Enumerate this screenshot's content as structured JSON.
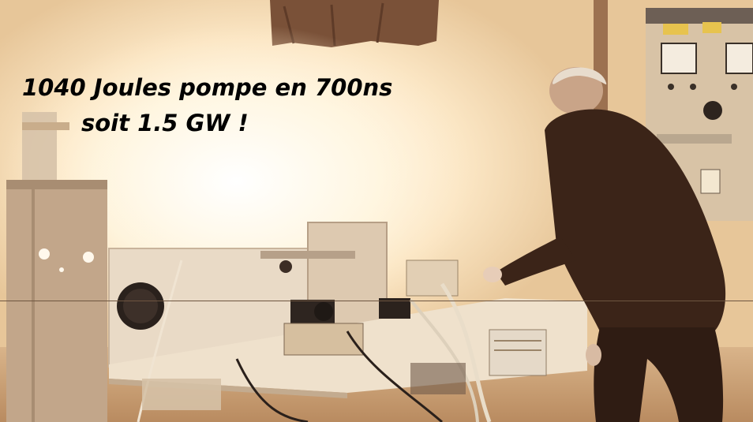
{
  "caption": {
    "line1": "1040 Joules pompe en 700ns",
    "line2": "soit  1.5 GW !"
  },
  "palette": {
    "glow": "#fffef8",
    "warm_wall": "#f3d7b0",
    "dark_clothing": "#3b2418",
    "metal_panel": "#c9b39a",
    "caption_text": "#000000"
  }
}
